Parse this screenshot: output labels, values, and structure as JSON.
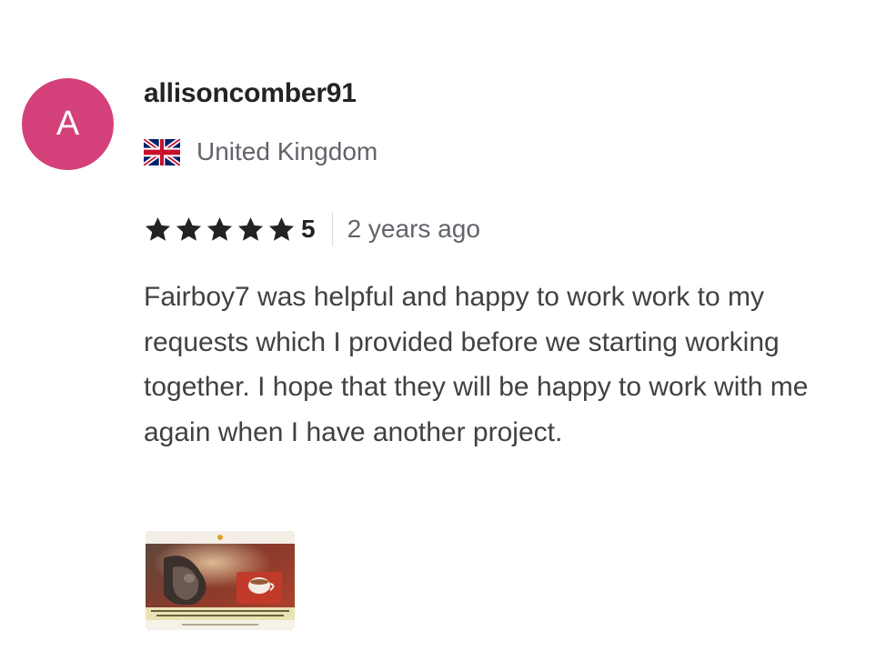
{
  "review": {
    "avatar_letter": "A",
    "avatar_color": "#d4417a",
    "username": "allisoncomber91",
    "country": "United Kingdom",
    "flag_icon": "uk-flag-icon",
    "rating": {
      "stars": 5,
      "value": "5",
      "star_icon": "star-icon"
    },
    "time_ago": "2 years ago",
    "text": "Fairboy7 was helpful and happy to work work to my requests which I provided before we starting working together. I hope that they will be happy to work with me again when I have another project.",
    "attachment": {
      "type": "image-thumbnail"
    }
  }
}
